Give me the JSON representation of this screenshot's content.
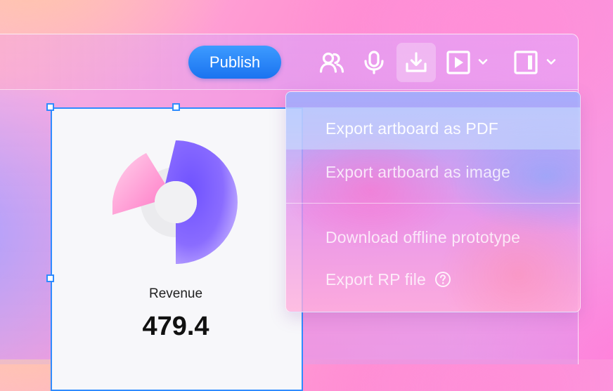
{
  "toolbar": {
    "publish_label": "Publish",
    "icons": [
      "users-icon",
      "microphone-icon",
      "download-icon",
      "play-icon",
      "chevron-down-icon",
      "panel-icon",
      "chevron-down-icon"
    ]
  },
  "artboard": {
    "metric_label": "Revenue",
    "metric_value": "479.4",
    "chart_colors": {
      "primary": "#7b5cff",
      "secondary": "#ff9fd8",
      "track": "#eeeeee"
    }
  },
  "export_menu": {
    "items": [
      {
        "label": "Export artboard as PDF"
      },
      {
        "label": "Export artboard as image"
      },
      {
        "label": "Download offline prototype"
      },
      {
        "label": "Export RP file"
      }
    ]
  },
  "colors": {
    "accent": "#2f8cff",
    "publish": "#1a73f0"
  }
}
